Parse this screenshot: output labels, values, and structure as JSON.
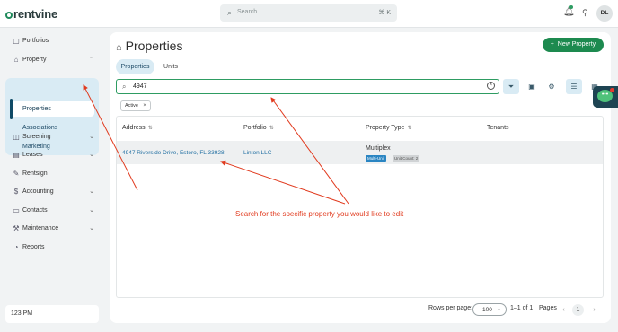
{
  "topbar": {
    "logo": "rentvine",
    "search_placeholder": "Search",
    "search_shortcut": "⌘ K",
    "avatar_initials": "DL",
    "bell_icon": "bell-icon",
    "user_icon": "user-icon"
  },
  "sidebar": {
    "items": [
      {
        "label": "Portfolios",
        "icon": "▢"
      },
      {
        "label": "Property",
        "icon": "⌂"
      },
      {
        "label": "Screening",
        "icon": "◫"
      },
      {
        "label": "Leases",
        "icon": "▤"
      },
      {
        "label": "Rentsign",
        "icon": "✎"
      },
      {
        "label": "Accounting",
        "icon": "$"
      },
      {
        "label": "Contacts",
        "icon": "▭"
      },
      {
        "label": "Maintenance",
        "icon": "⚒"
      },
      {
        "label": "Reports",
        "icon": "◔"
      }
    ],
    "sub_items": [
      "Properties",
      "Associations",
      "Marketing"
    ],
    "clock": "123 PM"
  },
  "main": {
    "title": "Properties",
    "new_button": "New Property",
    "tabs": [
      "Properties",
      "Units"
    ],
    "filter_value": "4947",
    "active_chip": "Active",
    "table": {
      "headers": [
        "Address",
        "Portfolio",
        "Property Type",
        "Tenants"
      ],
      "rows": [
        {
          "address": "4947 Riverside Drive, Estero, FL 33928",
          "portfolio": "Linton LLC",
          "type": "Multiplex",
          "badge1": "Multi-Unit",
          "badge2": "Unit Count: 2",
          "tenants": "-"
        }
      ]
    },
    "pagination": {
      "rows_per_page_label": "Rows per page:",
      "rows_per_page": "100",
      "range": "1–1 of 1",
      "pages_label": "Pages",
      "current_page": "1"
    }
  },
  "annotation": {
    "text": "Search for the specific property you would like to edit",
    "color": "#e13b1f"
  }
}
